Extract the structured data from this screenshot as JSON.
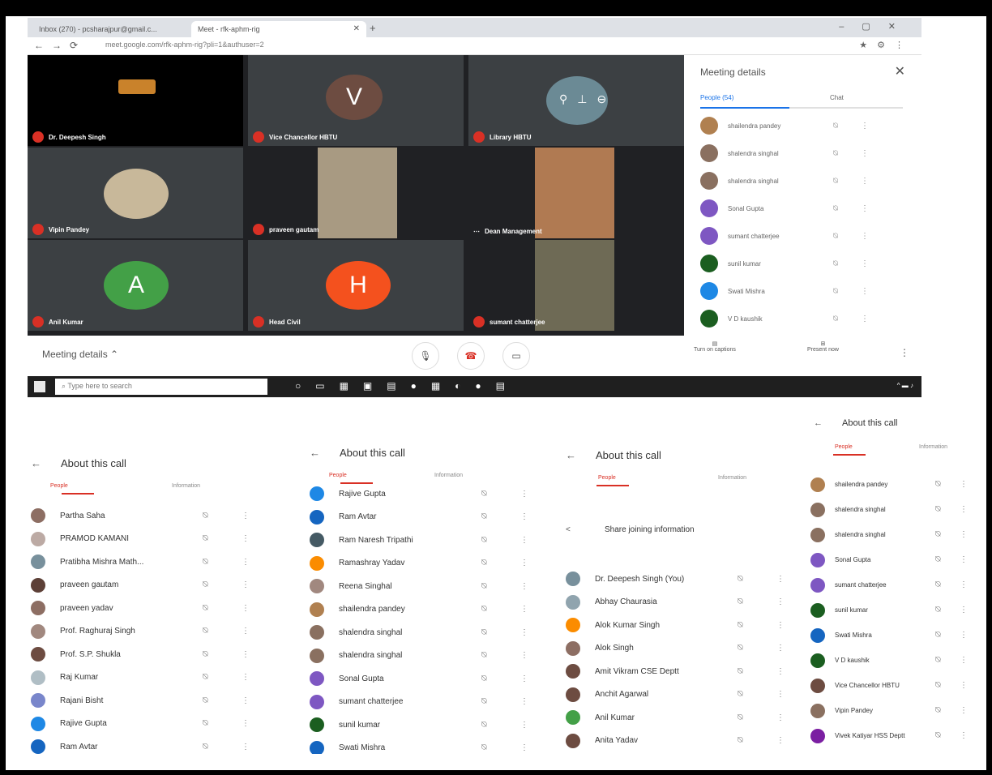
{
  "browser": {
    "tabs": [
      {
        "label": "Inbox (270) - pcsharajpur@gmail.c..."
      },
      {
        "label": "Meet - rfk-aphm-rig"
      }
    ],
    "url": "meet.google.com/rfk-aphm-rig?pli=1&authuser=2"
  },
  "meeting": {
    "tiles": [
      {
        "name": "Dr. Deepesh Singh",
        "kind": "logo"
      },
      {
        "name": "Vice Chancellor HBTU",
        "initial": "V",
        "color": "#6d4c41"
      },
      {
        "name": "Library HBTU",
        "kind": "icons"
      },
      {
        "name": "Vipin Pandey",
        "kind": "photo"
      },
      {
        "name": "praveen gautam",
        "kind": "video"
      },
      {
        "name": "Dean Management",
        "kind": "video"
      },
      {
        "name": "Anil Kumar",
        "initial": "A",
        "color": "#43a047"
      },
      {
        "name": "Head Civil",
        "initial": "H",
        "color": "#f4511e"
      },
      {
        "name": "sumant chatterjee",
        "kind": "video"
      }
    ],
    "details_label": "Meeting details",
    "captions_label": "Turn on captions",
    "present_label": "Present now"
  },
  "panel": {
    "title": "Meeting details",
    "people_tab": "People (54)",
    "chat_tab": "Chat",
    "people": [
      {
        "name": "shailendra pandey",
        "color": "#b08050"
      },
      {
        "name": "shalendra singhal",
        "color": "#8a7060"
      },
      {
        "name": "shalendra singhal",
        "color": "#8a7060"
      },
      {
        "name": "Sonal Gupta",
        "color": "#7e57c2"
      },
      {
        "name": "sumant chatterjee",
        "color": "#7e57c2"
      },
      {
        "name": "sunil kumar",
        "color": "#1b5e20"
      },
      {
        "name": "Swati Mishra",
        "color": "#1e88e5"
      },
      {
        "name": "V D kaushik",
        "color": "#1b5e20"
      }
    ]
  },
  "taskbar": {
    "search_placeholder": "Type here to search"
  },
  "phones": [
    {
      "title": "About this call",
      "tab_people": "People",
      "tab_info": "Information",
      "rows": [
        {
          "name": "Partha Saha",
          "color": "#8d6e63"
        },
        {
          "name": "PRAMOD KAMANI",
          "color": "#bcaaa4"
        },
        {
          "name": "Pratibha Mishra Math...",
          "color": "#78909c"
        },
        {
          "name": "praveen gautam",
          "color": "#5d4037"
        },
        {
          "name": "praveen yadav",
          "color": "#8d6e63"
        },
        {
          "name": "Prof. Raghuraj Singh",
          "color": "#a1887f"
        },
        {
          "name": "Prof. S.P. Shukla",
          "color": "#6d4c41"
        },
        {
          "name": "Raj Kumar",
          "color": "#b0bec5"
        },
        {
          "name": "Rajani Bisht",
          "color": "#7986cb"
        },
        {
          "name": "Rajive Gupta",
          "color": "#1e88e5"
        },
        {
          "name": "Ram Avtar",
          "color": "#1565c0"
        }
      ]
    },
    {
      "title": "About this call",
      "tab_people": "People",
      "tab_info": "Information",
      "rows": [
        {
          "name": "Rajive Gupta",
          "color": "#1e88e5"
        },
        {
          "name": "Ram Avtar",
          "color": "#1565c0"
        },
        {
          "name": "Ram Naresh Tripathi",
          "color": "#455a64"
        },
        {
          "name": "Ramashray Yadav",
          "color": "#fb8c00"
        },
        {
          "name": "Reena Singhal",
          "color": "#a1887f"
        },
        {
          "name": "shailendra pandey",
          "color": "#b08050"
        },
        {
          "name": "shalendra singhal",
          "color": "#8a7060"
        },
        {
          "name": "shalendra singhal",
          "color": "#8a7060"
        },
        {
          "name": "Sonal Gupta",
          "color": "#7e57c2"
        },
        {
          "name": "sumant chatterjee",
          "color": "#7e57c2"
        },
        {
          "name": "sunil kumar",
          "color": "#1b5e20"
        },
        {
          "name": "Swati Mishra",
          "color": "#1565c0"
        }
      ]
    },
    {
      "title": "About this call",
      "tab_people": "People",
      "tab_info": "Information",
      "share_label": "Share joining information",
      "rows": [
        {
          "name": "Dr. Deepesh Singh (You)",
          "color": "#78909c"
        },
        {
          "name": "Abhay Chaurasia",
          "color": "#90a4ae"
        },
        {
          "name": "Alok Kumar Singh",
          "color": "#fb8c00"
        },
        {
          "name": "Alok Singh",
          "color": "#8d6e63"
        },
        {
          "name": "Amit Vikram CSE Deptt",
          "color": "#6d4c41"
        },
        {
          "name": "Anchit Agarwal",
          "color": "#6d4c41"
        },
        {
          "name": "Anil Kumar",
          "color": "#43a047"
        },
        {
          "name": "Anita Yadav",
          "color": "#6d4c41"
        }
      ]
    },
    {
      "title": "About this call",
      "tab_people": "People",
      "tab_info": "Information",
      "rows": [
        {
          "name": "shailendra pandey",
          "color": "#b08050"
        },
        {
          "name": "shalendra singhal",
          "color": "#8a7060"
        },
        {
          "name": "shalendra singhal",
          "color": "#8a7060"
        },
        {
          "name": "Sonal Gupta",
          "color": "#7e57c2"
        },
        {
          "name": "sumant chatterjee",
          "color": "#7e57c2"
        },
        {
          "name": "sunil kumar",
          "color": "#1b5e20"
        },
        {
          "name": "Swati Mishra",
          "color": "#1565c0"
        },
        {
          "name": "V D kaushik",
          "color": "#1b5e20"
        },
        {
          "name": "Vice Chancellor HBTU",
          "color": "#6d4c41"
        },
        {
          "name": "Vipin Pandey",
          "color": "#8a7060"
        },
        {
          "name": "Vivek Katiyar HSS Deptt",
          "color": "#7b1fa2"
        }
      ]
    }
  ]
}
